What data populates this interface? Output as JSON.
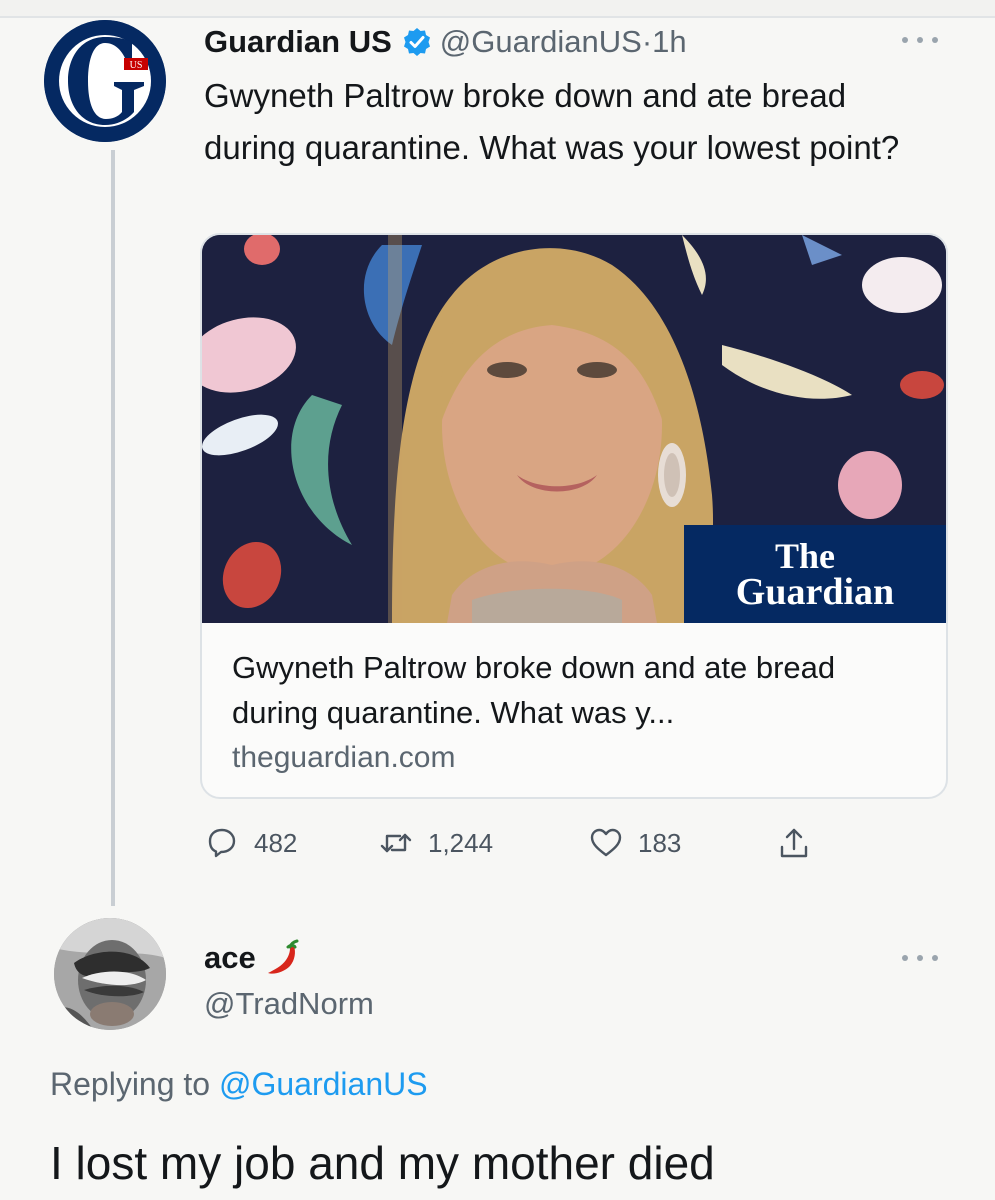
{
  "tweet": {
    "author_name": "Guardian US",
    "handle": "@GuardianUS",
    "separator": "·",
    "time": "1h",
    "text": "Gwyneth Paltrow broke down and ate bread during quarantine. What was your lowest point?",
    "card": {
      "logo_line1": "The",
      "logo_line2": "Guardian",
      "title": "Gwyneth Paltrow broke down and ate bread during quarantine. What was y...",
      "domain": "theguardian.com"
    },
    "actions": {
      "replies": "482",
      "retweets": "1,244",
      "likes": "183"
    },
    "avatar_badge": "US"
  },
  "reply": {
    "author_name": "ace",
    "handle": "@TradNorm",
    "replying_prefix": "Replying to",
    "replying_to": "@GuardianUS",
    "text": "I lost my job and my mother died"
  },
  "icons": {
    "verified": "verified-badge-icon",
    "more": "more-options-icon",
    "reply": "reply-icon",
    "retweet": "retweet-icon",
    "like": "heart-icon",
    "share": "share-icon",
    "emoji": "chili-pepper-icon"
  },
  "colors": {
    "accent": "#1d9bf0",
    "guardian_navy": "#052962",
    "secondary_text": "#5b6670"
  }
}
